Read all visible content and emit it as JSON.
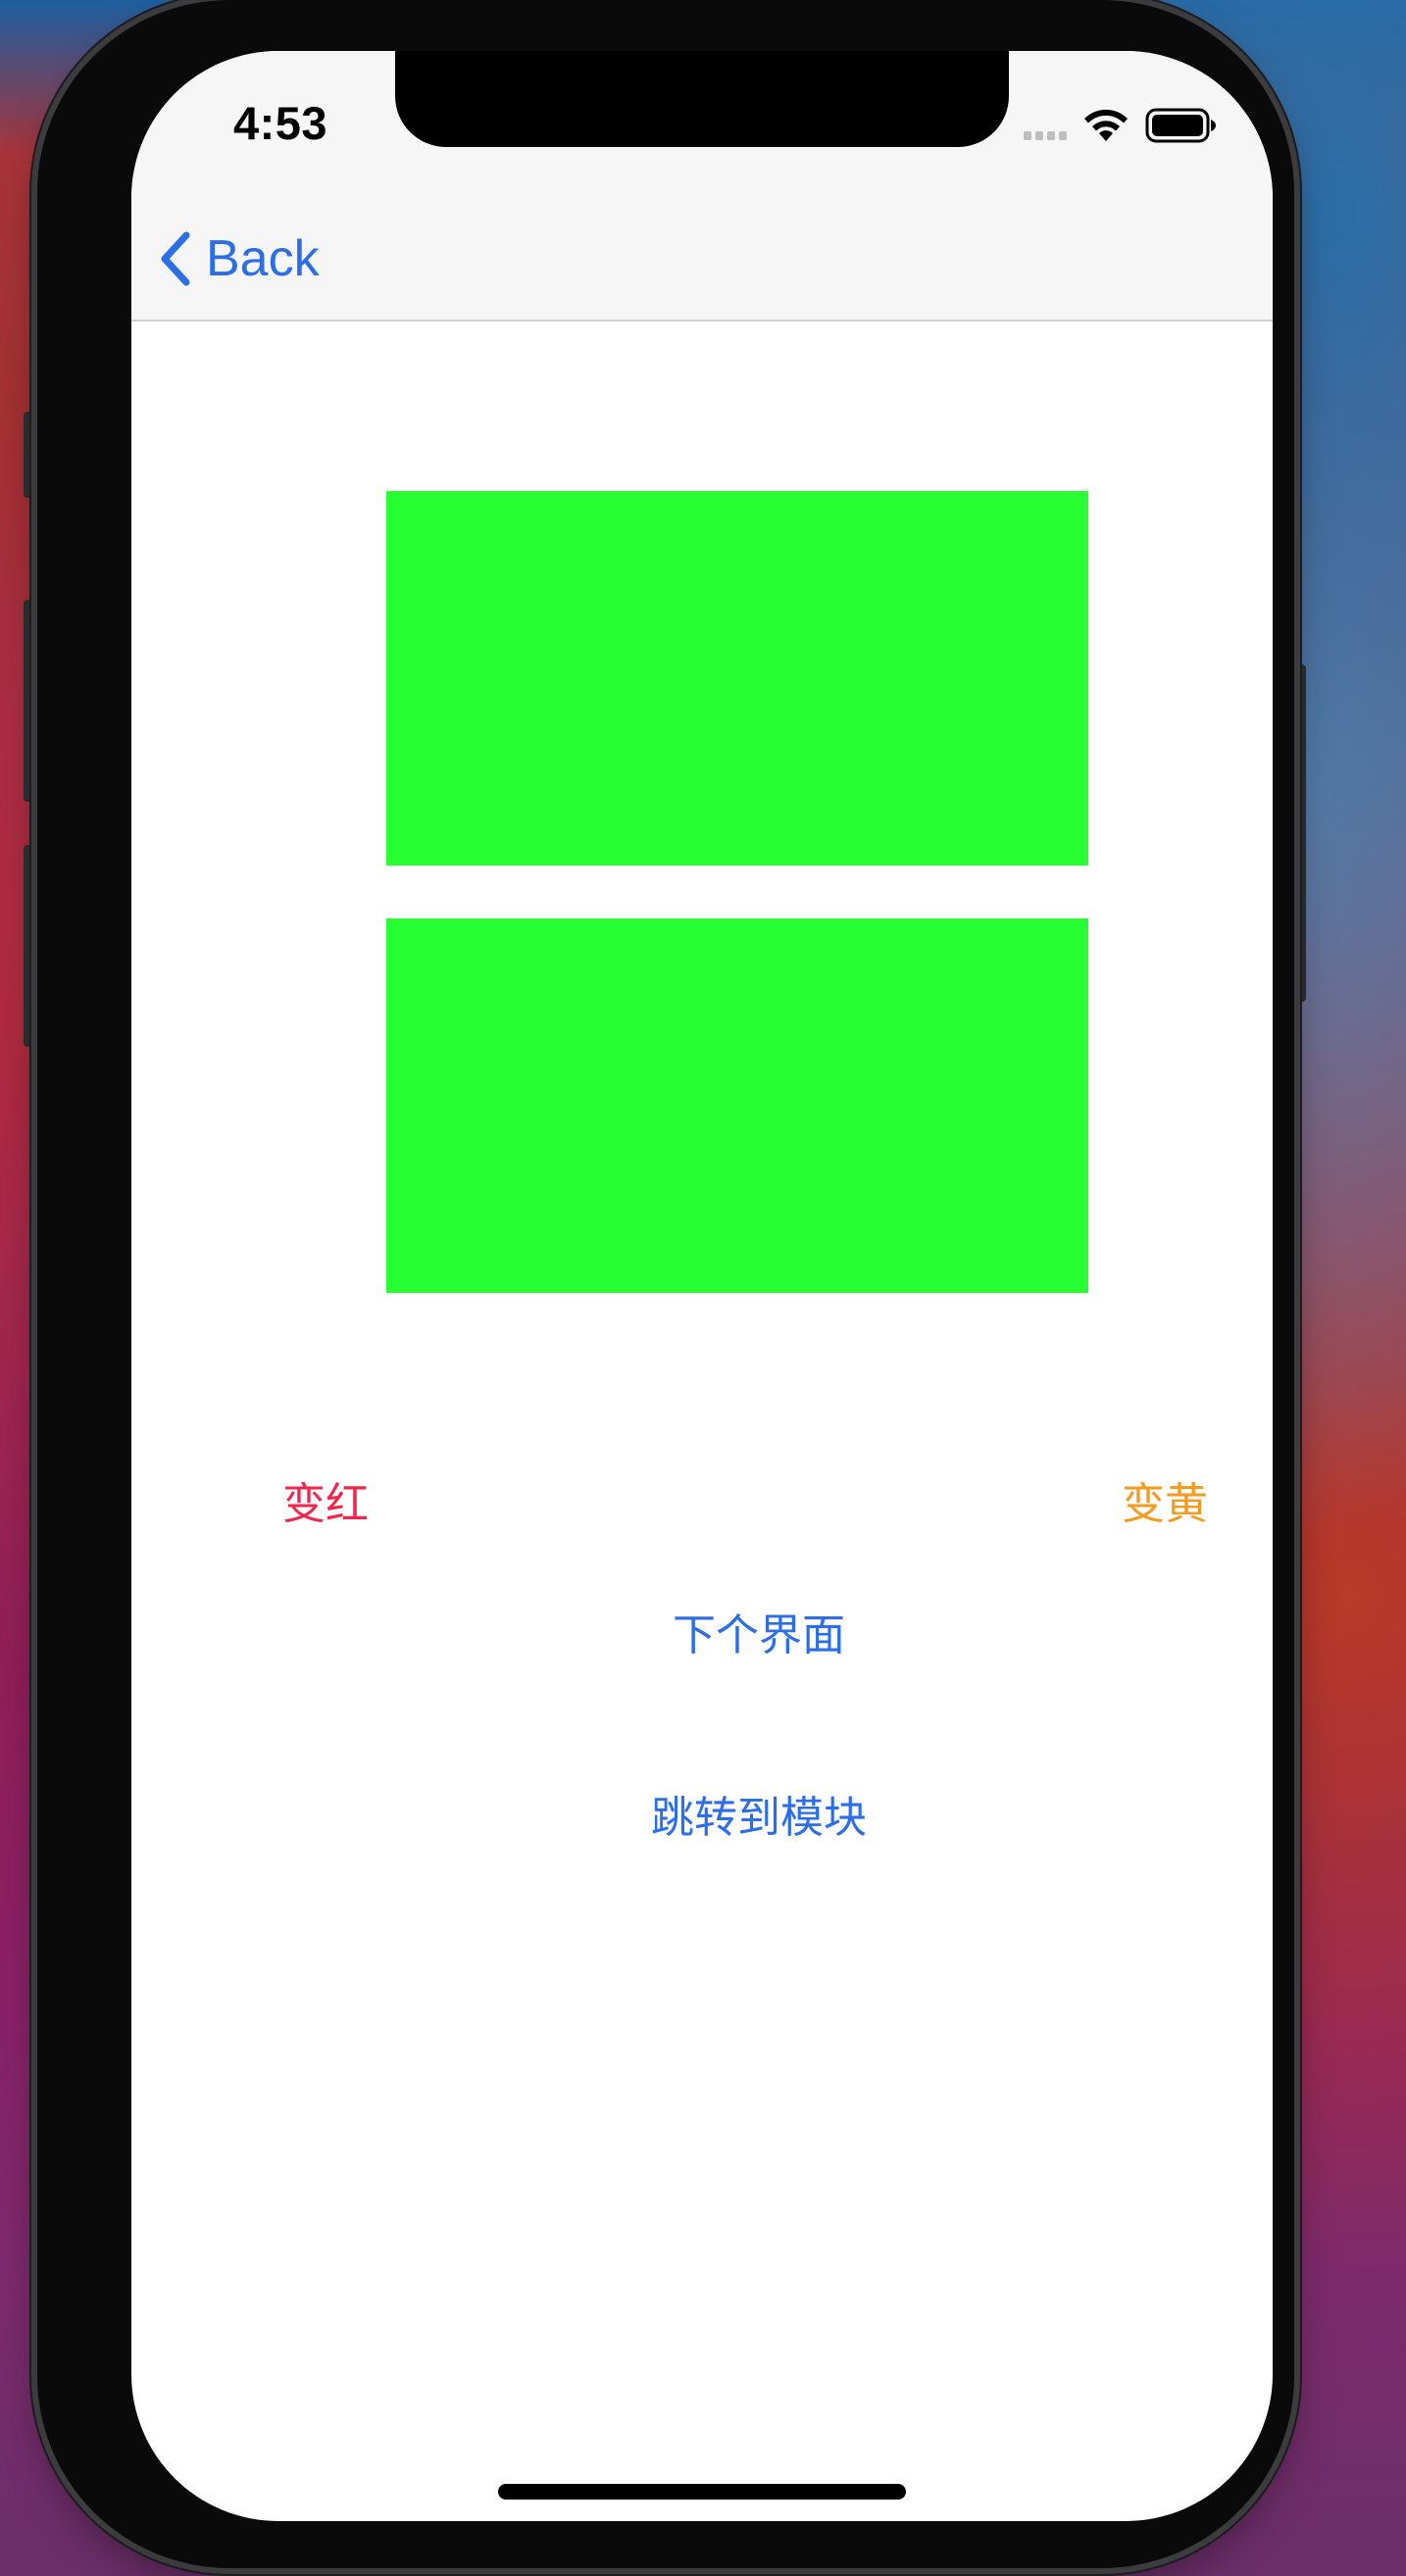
{
  "status_bar": {
    "time": "4:53",
    "signal_icon": "signal-bars-icon",
    "wifi_icon": "wifi-icon",
    "battery_icon": "battery-icon"
  },
  "nav_bar": {
    "back_icon": "chevron-left-icon",
    "back_label": "Back"
  },
  "content": {
    "boxes": [
      {
        "color": "#28ff32"
      },
      {
        "color": "#28ff32"
      }
    ],
    "buttons": {
      "red_label": "变红",
      "yellow_label": "变黄",
      "next_label": "下个界面",
      "module_label": "跳转到模块"
    }
  },
  "colors": {
    "accent": "#2b6ee8",
    "red": "#f0264a",
    "orange": "#f49a1e"
  }
}
